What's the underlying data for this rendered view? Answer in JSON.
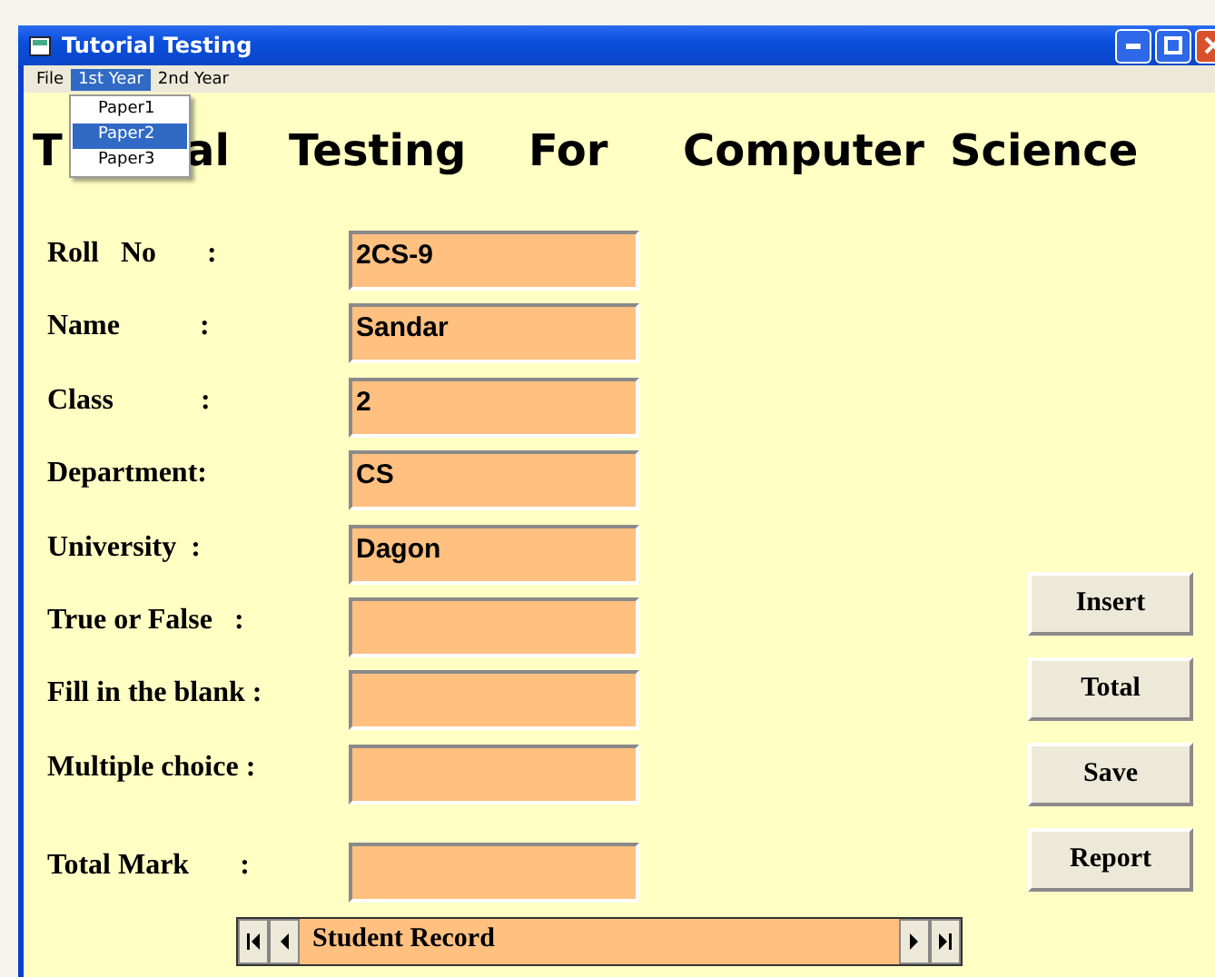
{
  "window": {
    "title": "Tutorial Testing"
  },
  "menu_bar": [
    {
      "label": "File",
      "selected": false
    },
    {
      "label": "1st Year",
      "selected": true
    },
    {
      "label": "2nd Year",
      "selected": false
    }
  ],
  "open_menu": {
    "items": [
      {
        "label": "Paper1",
        "selected": false
      },
      {
        "label": "Paper2",
        "selected": true
      },
      {
        "label": "Paper3",
        "selected": false
      }
    ]
  },
  "heading": [
    "T",
    "al",
    "Testing",
    "For",
    "Computer",
    "Science"
  ],
  "fields": [
    {
      "label": "Roll   No       :",
      "value": "2CS-9"
    },
    {
      "label": "Name           :",
      "value": "Sandar"
    },
    {
      "label": "Class            :",
      "value": "2"
    },
    {
      "label": "Department:",
      "value": "CS"
    },
    {
      "label": "University  :",
      "value": "Dagon"
    },
    {
      "label": "True or False   :"
    },
    {
      "label": "Fill in the blank :"
    },
    {
      "label": "Multiple choice :"
    },
    {
      "label": "Total Mark       :"
    }
  ],
  "buttons": [
    "Insert",
    "Total",
    "Save",
    "Report"
  ],
  "record_navigator": {
    "caption": "Student Record"
  }
}
